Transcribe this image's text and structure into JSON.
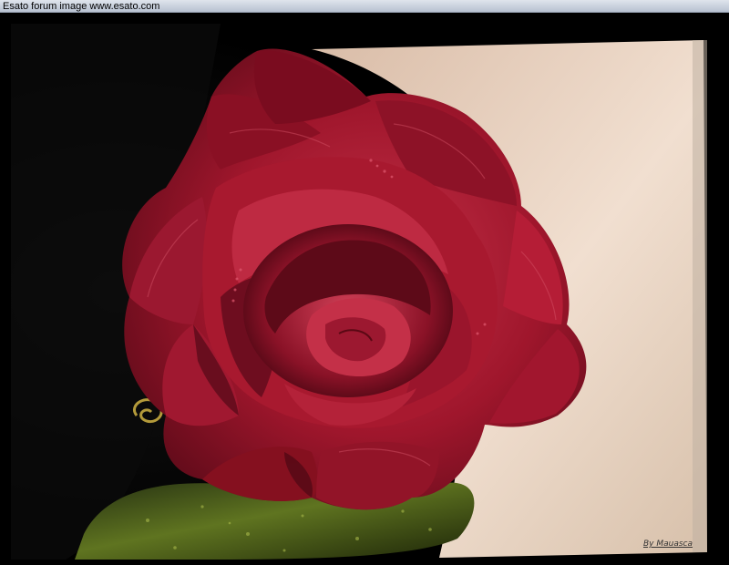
{
  "window": {
    "title": "Esato forum image www.esato.com"
  },
  "photo": {
    "subject": "red velvet rose",
    "signature": "By Mauasca",
    "colors": {
      "background_dark": "#050505",
      "wall": "#e7d3c1",
      "rose_deep": "#6e0d1f",
      "rose_mid": "#a3152d",
      "rose_light": "#c32c43",
      "leaf_green": "#55661a"
    }
  }
}
